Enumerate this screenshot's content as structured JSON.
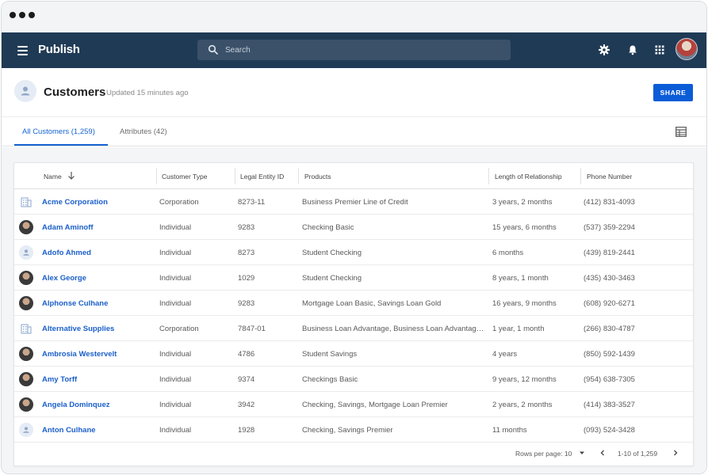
{
  "app": {
    "title": "Publish"
  },
  "search": {
    "placeholder": "Search"
  },
  "nav_icons": [
    "settings-icon",
    "bell-icon",
    "apps-grid-icon"
  ],
  "page": {
    "title": "Customers",
    "updated": "Updated 15 minutes ago",
    "share_label": "SHARE"
  },
  "tabs": [
    {
      "label": "All Customers (1,259)",
      "active": true
    },
    {
      "label": "Attributes (42)",
      "active": false
    }
  ],
  "table": {
    "columns": [
      "Name",
      "Customer Type",
      "Legal Entity ID",
      "Products",
      "Length of Relationship",
      "Phone Number"
    ],
    "rows": [
      {
        "avatar": "building",
        "name": "Acme Corporation",
        "type": "Corporation",
        "entity_id": "8273-11",
        "products": "Business  Premier Line of Credit",
        "length": "3 years, 2 months",
        "phone": "(412) 831-4093"
      },
      {
        "avatar": "photo",
        "name": "Adam Aminoff",
        "type": "Individual",
        "entity_id": "9283",
        "products": "Checking Basic",
        "length": "15 years, 6 months",
        "phone": "(537) 359-2294"
      },
      {
        "avatar": "person",
        "name": "Adofo Ahmed",
        "type": "Individual",
        "entity_id": "8273",
        "products": "Student Checking",
        "length": "6 months",
        "phone": "(439) 819-2441"
      },
      {
        "avatar": "photo",
        "name": "Alex George",
        "type": "Individual",
        "entity_id": "1029",
        "products": "Student Checking",
        "length": "8 years, 1 month",
        "phone": "(435) 430-3463"
      },
      {
        "avatar": "photo",
        "name": "Alphonse Culhane",
        "type": "Individual",
        "entity_id": "9283",
        "products": "Mortgage Loan Basic, Savings Loan Gold",
        "length": "16 years, 9 months",
        "phone": "(608) 920-6271"
      },
      {
        "avatar": "building",
        "name": "Alternative Supplies",
        "type": "Corporation",
        "entity_id": "7847-01",
        "products": "Business Loan Advantage, Business Loan Advantage Plus",
        "length": "1 year, 1 month",
        "phone": "(266) 830-4787"
      },
      {
        "avatar": "photo",
        "name": "Ambrosia Westervelt",
        "type": "Individual",
        "entity_id": "4786",
        "products": "Student Savings",
        "length": "4 years",
        "phone": "(850) 592-1439"
      },
      {
        "avatar": "photo",
        "name": "Amy Torff",
        "type": "Individual",
        "entity_id": "9374",
        "products": "Checkings Basic",
        "length": "9 years, 12 months",
        "phone": "(954) 638-7305"
      },
      {
        "avatar": "photo",
        "name": "Angela Dominquez",
        "type": "Individual",
        "entity_id": "3942",
        "products": "Checking, Savings, Mortgage Loan Premier",
        "length": "2 years, 2 months",
        "phone": "(414) 383-3527"
      },
      {
        "avatar": "person",
        "name": "Anton Culhane",
        "type": "Individual",
        "entity_id": "1928",
        "products": "Checking, Savings Premier",
        "length": "11 months",
        "phone": "(093) 524-3428"
      }
    ]
  },
  "pagination": {
    "rows_per_page_label": "Rows per page: 10",
    "range": "1-10 of 1,259"
  },
  "colors": {
    "navbar": "#1f3a55",
    "accent": "#0b5cd7",
    "link": "#1b5fc9"
  }
}
